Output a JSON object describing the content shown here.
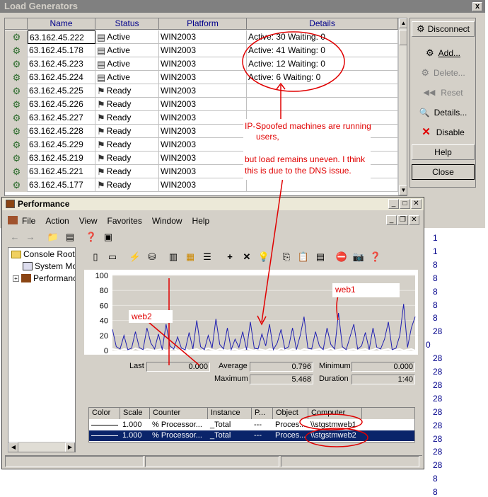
{
  "load_generators": {
    "title": "Load Generators",
    "close_label": "x",
    "columns": [
      "Name",
      "Status",
      "Platform",
      "Details"
    ],
    "rows": [
      {
        "name": "63.162.45.222",
        "status": "Active",
        "platform": "WIN2003",
        "details": "Active: 30 Waiting: 0"
      },
      {
        "name": "63.162.45.178",
        "status": "Active",
        "platform": "WIN2003",
        "details": "Active: 41 Waiting: 0"
      },
      {
        "name": "63.162.45.223",
        "status": "Active",
        "platform": "WIN2003",
        "details": "Active: 12 Waiting: 0"
      },
      {
        "name": "63.162.45.224",
        "status": "Active",
        "platform": "WIN2003",
        "details": "Active: 6 Waiting: 0"
      },
      {
        "name": "63.162.45.225",
        "status": "Ready",
        "platform": "WIN2003",
        "details": ""
      },
      {
        "name": "63.162.45.226",
        "status": "Ready",
        "platform": "WIN2003",
        "details": ""
      },
      {
        "name": "63.162.45.227",
        "status": "Ready",
        "platform": "WIN2003",
        "details": ""
      },
      {
        "name": "63.162.45.228",
        "status": "Ready",
        "platform": "WIN2003",
        "details": ""
      },
      {
        "name": "63.162.45.229",
        "status": "Ready",
        "platform": "WIN2003",
        "details": ""
      },
      {
        "name": "63.162.45.219",
        "status": "Ready",
        "platform": "WIN2003",
        "details": ""
      },
      {
        "name": "63.162.45.221",
        "status": "Ready",
        "platform": "WIN2003",
        "details": ""
      },
      {
        "name": "63.162.45.177",
        "status": "Ready",
        "platform": "WIN2003",
        "details": ""
      }
    ],
    "buttons": {
      "disconnect": "Disconnect",
      "add": "Add...",
      "delete": "Delete...",
      "reset": "Reset",
      "details": "Details...",
      "disable": "Disable",
      "help": "Help",
      "close": "Close"
    }
  },
  "annotations": {
    "line1": "IP-Spoofed machines are running",
    "line2": "users,",
    "line3": "but load remains uneven. I think",
    "line4": "this is due to the DNS issue.",
    "web1": "web1",
    "web2": "web2"
  },
  "performance": {
    "title": "Performance",
    "menu": [
      "File",
      "Action",
      "View",
      "Favorites",
      "Window",
      "Help"
    ],
    "tree": {
      "root": "Console Root",
      "child1": "System Mon",
      "child2": "Performanc"
    },
    "stats": {
      "last_label": "Last",
      "last_value": "0.000",
      "average_label": "Average",
      "average_value": "0.796",
      "minimum_label": "Minimum",
      "minimum_value": "0.000",
      "maximum_label": "Maximum",
      "maximum_value": "5.468",
      "duration_label": "Duration",
      "duration_value": "1:40"
    },
    "counter_columns": [
      "Color",
      "Scale",
      "Counter",
      "Instance",
      "P...",
      "Object",
      "Computer"
    ],
    "counters": [
      {
        "scale": "1.000",
        "counter": "% Processor...",
        "instance": "_Total",
        "parent": "---",
        "object": "Proces...",
        "computer": "\\\\stgstmweb1",
        "color": "#000000"
      },
      {
        "scale": "1.000",
        "counter": "% Processor...",
        "instance": "_Total",
        "parent": "---",
        "object": "Proces...",
        "computer": "\\\\stgstmweb2",
        "color": "#8a2be2"
      }
    ]
  },
  "background_column": [
    "1",
    "1",
    "8",
    "8",
    "8",
    "8",
    "8",
    "28",
    "0",
    "28",
    "28",
    "28",
    "28",
    "28",
    "28",
    "28",
    "28",
    "28",
    "8",
    "8"
  ],
  "chart_data": {
    "type": "line",
    "title": "",
    "xlabel": "",
    "ylabel": "",
    "ylim": [
      0,
      100
    ],
    "yticks": [
      0,
      20,
      40,
      60,
      80,
      100
    ],
    "series": [
      {
        "name": "\\\\stgstmweb1",
        "color": "#ffffff",
        "values": [
          2,
          1,
          0,
          2,
          1,
          0,
          3,
          1,
          0,
          2,
          1,
          0,
          1,
          2,
          0,
          1,
          3,
          0,
          1,
          2,
          0,
          1,
          2,
          0,
          1,
          3,
          1,
          0,
          2,
          1,
          0,
          1,
          2,
          0,
          1,
          3,
          1,
          0,
          2,
          1,
          0,
          2,
          1,
          0,
          3,
          1,
          0,
          2,
          1,
          0,
          2,
          1,
          0,
          1,
          2,
          0,
          1,
          3,
          0,
          1,
          2,
          0,
          1,
          2,
          0,
          1,
          2,
          0,
          1,
          3,
          0,
          1,
          2,
          0,
          1,
          2,
          0,
          1,
          2,
          0
        ]
      },
      {
        "name": "\\\\stgstmweb2",
        "color": "#2020b0",
        "values": [
          28,
          5,
          2,
          20,
          1,
          3,
          25,
          4,
          1,
          30,
          10,
          2,
          22,
          1,
          35,
          6,
          2,
          18,
          3,
          1,
          24,
          2,
          40,
          5,
          1,
          20,
          3,
          42,
          8,
          2,
          30,
          1,
          15,
          4,
          25,
          1,
          38,
          3,
          2,
          22,
          6,
          35,
          1,
          10,
          28,
          2,
          5,
          30,
          1,
          20,
          45,
          3,
          2,
          25,
          6,
          1,
          30,
          8,
          2,
          50,
          5,
          1,
          18,
          35,
          2,
          6,
          24,
          1,
          30,
          4,
          2,
          15,
          38,
          1,
          3,
          20,
          62,
          4,
          30,
          45
        ]
      }
    ]
  }
}
